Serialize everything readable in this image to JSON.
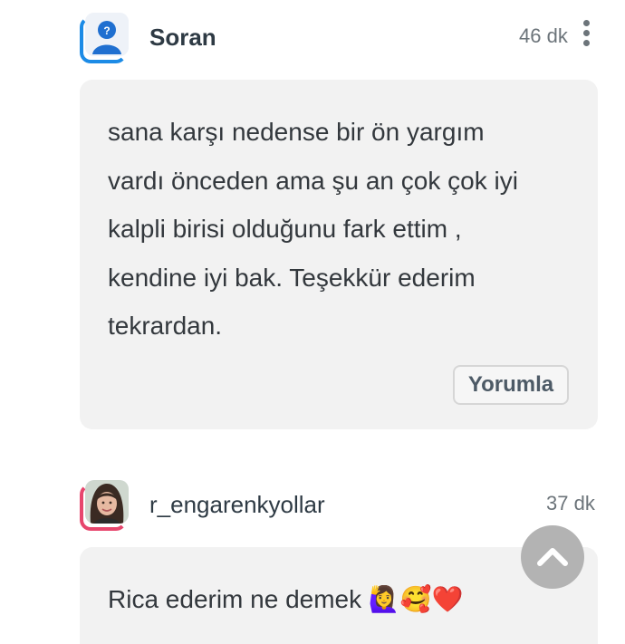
{
  "comments": [
    {
      "username": "Soran",
      "time": "46 dk",
      "avatar": "anonymous-user-icon",
      "lines": [
        "sana karşı nedense bir ön yargım",
        "vardı önceden ama şu an çok çok iyi",
        "kalpli birisi olduğunu fark ettim ,",
        "kendine iyi bak. Teşekkür ederim",
        "tekrardan."
      ],
      "reply_label": "Yorumla"
    },
    {
      "username": "r_engarenkyollar",
      "time": "37 dk",
      "avatar": "user-photo",
      "text": "Rica ederim ne demek 🙋‍♀️🥰❤️"
    }
  ],
  "colors": {
    "ring_blue": "#1c8be6",
    "ring_pink": "#e7466d",
    "bubble_bg": "#f2f2f2",
    "scroll_button": "#b3b3b3"
  },
  "icons": {
    "menu": "more-vertical-icon",
    "scroll": "chevron-up-icon"
  }
}
